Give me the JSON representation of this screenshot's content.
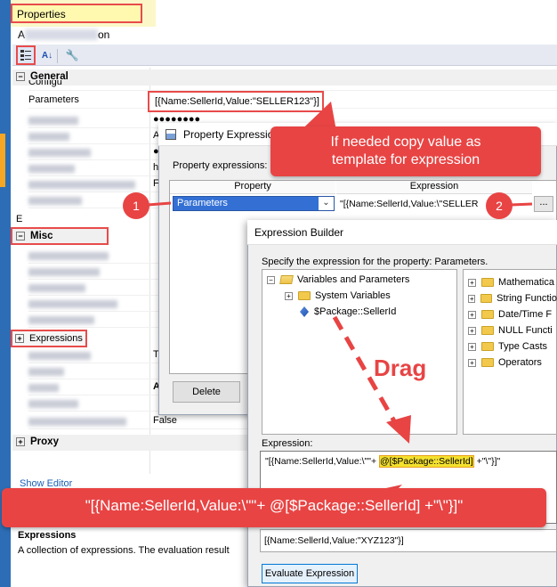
{
  "properties_panel": {
    "title": "Properties",
    "object_name_suffix": "on",
    "object_name_prefix": "A",
    "categories": {
      "general": "General",
      "misc": "Misc",
      "proxy": "Proxy"
    },
    "rows": {
      "config_partial": "Configu",
      "parameters_label": "Parameters",
      "parameters_value": "[{Name:SellerId,Value:\"SELLER123\"}]",
      "password_value": "●●●●●●●●",
      "expressions_label": "Expressions",
      "false_value": "False",
      "value_a1": "A",
      "value_a2": "A",
      "value_h": "h",
      "value_f": "F",
      "value_bullet": "●",
      "value_t": "T",
      "value_bold_a": "A",
      "category_e": "E"
    },
    "show_editor": "Show Editor",
    "description_title": "Expressions",
    "description_text": "A collection of expressions. The evaluation result"
  },
  "property_expressions_editor": {
    "title": "Property Expressio",
    "label": "Property expressions:",
    "col_property": "Property",
    "col_expression": "Expression",
    "selected_property": "Parameters",
    "expression_value": "\"[{Name:SellerId,Value:\\\"SELLER",
    "ellipsis": "...",
    "delete_label": "Delete"
  },
  "expression_builder": {
    "title": "Expression Builder",
    "specify_label": "Specify the expression for the property: Parameters.",
    "tree": {
      "variables_and_parameters": "Variables and Parameters",
      "system_variables": "System Variables",
      "package_sellerid": "$Package::SellerId"
    },
    "functions": [
      "Mathematica",
      "String Functio",
      "Date/Time F",
      "NULL Functi",
      "Type Casts",
      "Operators"
    ],
    "expression_label": "Expression:",
    "expression_before": "\"[{Name:SellerId,Value:\\\"\"+ ",
    "expression_highlight": "@[$Package::SellerId]",
    "expression_after": " +\"\\\"}]\"",
    "evaluated_value": "[{Name:SellerId,Value:\"XYZ123\"}]",
    "evaluate_button": "Evaluate Expression"
  },
  "annotations": {
    "callout_top_line1": "If needed copy value as",
    "callout_top_line2": "template for expression",
    "callout_bottom": "\"[{Name:SellerId,Value:\\\"\"+ @[$Package::SellerId] +\"\\\"}]\"",
    "badge_1": "1",
    "badge_2": "2",
    "drag_label": "Drag"
  },
  "colors": {
    "annotation_red": "#e84444",
    "selection_blue": "#3470d4",
    "highlight_yellow": "#f4e12e"
  }
}
